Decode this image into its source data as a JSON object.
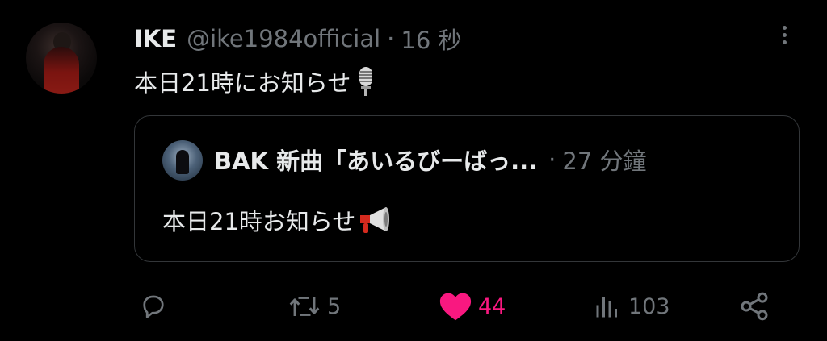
{
  "tweet": {
    "author_name": "IKE",
    "handle": "@ike1984official",
    "separator": "·",
    "time": "16 秒",
    "text": "本日21時にお知らせ",
    "text_emoji_icon": "microphone-icon"
  },
  "quoted_tweet": {
    "author_name": "BAK 新曲「あいるびーばっ...",
    "separator": "·",
    "time": "27 分鐘",
    "text": "本日21時お知らせ",
    "text_emoji_icon": "megaphone-icon"
  },
  "actions": {
    "reply_count": "",
    "retweet_count": "5",
    "like_count": "44",
    "view_count": "103",
    "liked": true
  },
  "colors": {
    "background": "#000000",
    "text_primary": "#e7e9ea",
    "text_secondary": "#71767b",
    "like_active": "#f91880",
    "border": "#333639"
  }
}
